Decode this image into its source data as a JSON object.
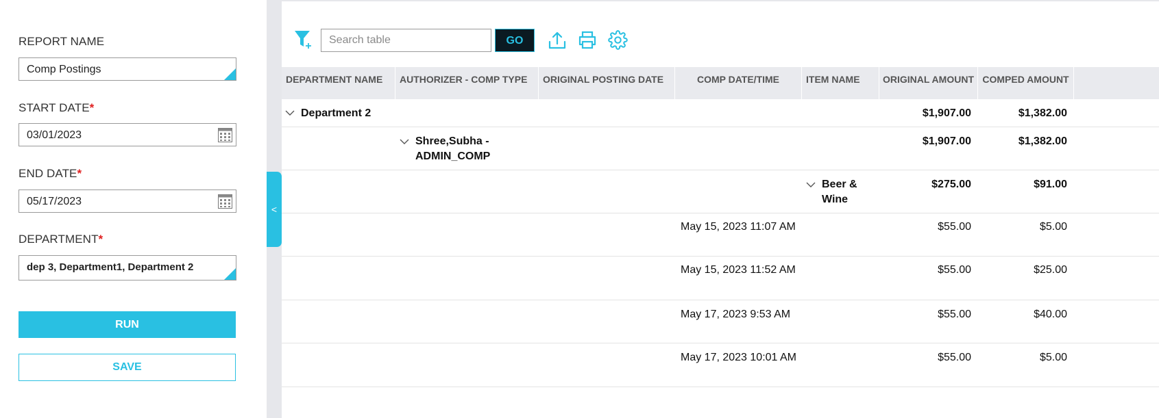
{
  "form": {
    "report_name_label": "REPORT NAME",
    "report_name_value": "Comp Postings",
    "start_date_label": "START DATE",
    "start_date_value": "03/01/2023",
    "end_date_label": "END DATE",
    "end_date_value": "05/17/2023",
    "department_label": "DEPARTMENT",
    "department_value": "dep 3, Department1, Department 2",
    "required_mark": "*",
    "run_label": "RUN",
    "save_label": "SAVE"
  },
  "panel_toggle": "<",
  "toolbar": {
    "search_placeholder": "Search table",
    "go_label": "GO",
    "icons": [
      "filter-add-icon",
      "export-icon",
      "print-icon",
      "settings-icon"
    ]
  },
  "table": {
    "columns": [
      "DEPARTMENT NAME",
      "AUTHORIZER - COMP TYPE",
      "ORIGINAL POSTING DATE",
      "COMP DATE/TIME",
      "ITEM NAME",
      "ORIGINAL AMOUNT",
      "COMPED AMOUNT"
    ],
    "group_department": {
      "name": "Department 2",
      "original": "$1,907.00",
      "comped": "$1,382.00"
    },
    "group_authorizer": {
      "name_line1": "Shree,Subha -",
      "name_line2": "ADMIN_COMP",
      "original": "$1,907.00",
      "comped": "$1,382.00"
    },
    "group_item": {
      "name_line1": "Beer &",
      "name_line2": "Wine",
      "original": "$275.00",
      "comped": "$91.00"
    },
    "rows": [
      {
        "comp_datetime": "May 15, 2023 11:07 AM",
        "original": "$55.00",
        "comped": "$5.00"
      },
      {
        "comp_datetime": "May 15, 2023 11:52 AM",
        "original": "$55.00",
        "comped": "$25.00"
      },
      {
        "comp_datetime": "May 17, 2023 9:53 AM",
        "original": "$55.00",
        "comped": "$40.00"
      },
      {
        "comp_datetime": "May 17, 2023 10:01 AM",
        "original": "$55.00",
        "comped": "$5.00"
      }
    ]
  },
  "colors": {
    "accent": "#29c0e2",
    "header_bg": "#e9eaee",
    "go_bg": "#0b1a22",
    "required": "#e02020"
  }
}
